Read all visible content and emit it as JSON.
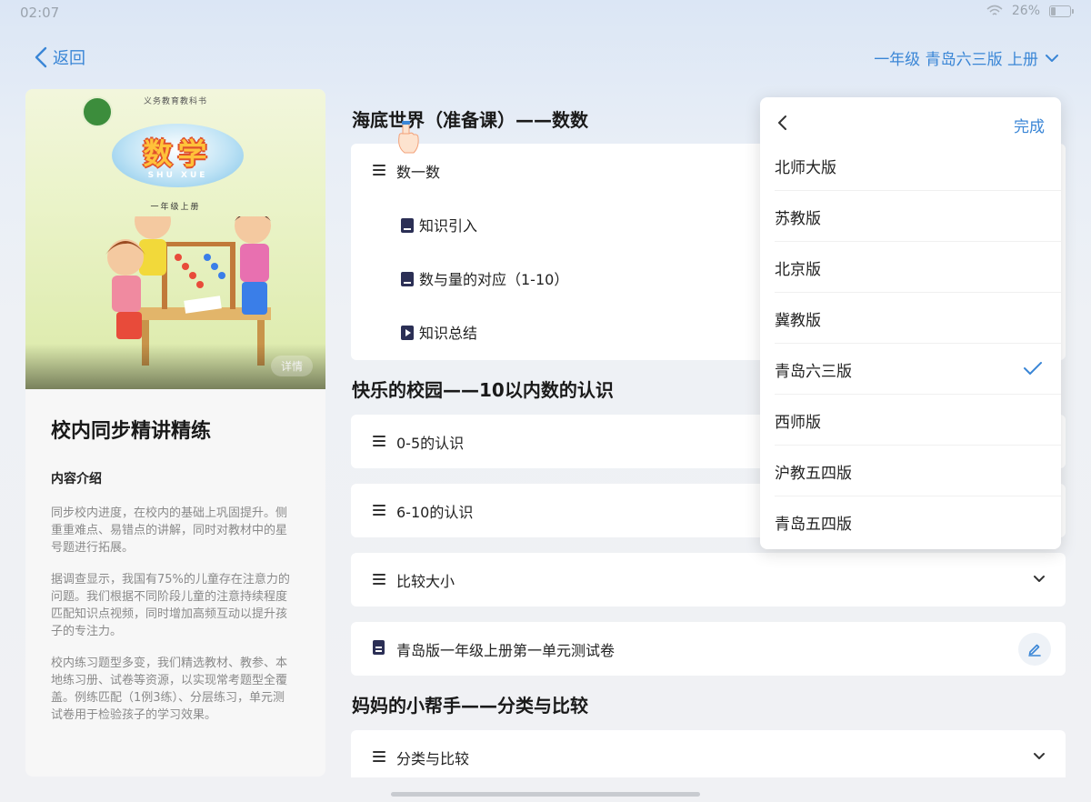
{
  "status": {
    "time": "02:07",
    "battery": "26%",
    "battery_level": 0.26
  },
  "header": {
    "back_label": "返回",
    "grade_select": "一年级 青岛六三版 上册"
  },
  "cover": {
    "top_text": "义务教育教科书",
    "title": "数学",
    "pinyin": "SHU XUE",
    "grade": "一年级上册",
    "detail_label": "详情"
  },
  "course": {
    "title": "校内同步精讲精练",
    "intro_label": "内容介绍",
    "intro_paragraphs": [
      "同步校内进度，在校内的基础上巩固提升。侧重重难点、易错点的讲解，同时对教材中的星号题进行拓展。",
      "据调查显示，我国有75%的儿童存在注意力的问题。我们根据不同阶段儿童的注意持续程度匹配知识点视频，同时增加高频互动以提升孩子的专注力。",
      "校内练习题型多变，我们精选教材、教参、本地练习册、试卷等资源，以实现常考题型全覆盖。例练匹配（1例3练）、分层练习，单元测试卷用于检验孩子的学习效果。"
    ]
  },
  "sections": [
    {
      "title": "海底世界（准备课）——数数",
      "lessons": [
        {
          "label": "数一数",
          "children": [
            {
              "label": "知识引入",
              "icon": "book-icon"
            },
            {
              "label": "数与量的对应（1-10）",
              "icon": "book-icon"
            },
            {
              "label": "知识总结",
              "icon": "play-icon"
            }
          ]
        }
      ]
    },
    {
      "title": "快乐的校园——10以内数的认识",
      "lessons": [
        {
          "label": "0-5的认识"
        },
        {
          "label": "6-10的认识"
        },
        {
          "label": "比较大小"
        },
        {
          "label": "青岛版一年级上册第一单元测试卷",
          "icon": "document-icon"
        }
      ]
    },
    {
      "title": "妈妈的小帮手——分类与比较",
      "lessons": [
        {
          "label": "分类与比较"
        }
      ]
    }
  ],
  "dropdown": {
    "done_label": "完成",
    "options": [
      "北师大版",
      "苏教版",
      "北京版",
      "冀教版",
      "青岛六三版",
      "西师版",
      "沪教五四版",
      "青岛五四版"
    ],
    "selected": "青岛六三版"
  },
  "colors": {
    "accent": "#3a86d6",
    "icon_dark": "#2b2f55"
  }
}
